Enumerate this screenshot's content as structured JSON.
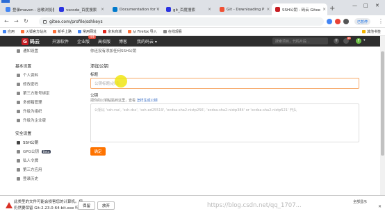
{
  "browser": {
    "tabs": [
      {
        "title": "登录maven - 谷歌浏览器",
        "color": "#4285f4"
      },
      {
        "title": "vscode_百度搜索",
        "color": "#2932e1"
      },
      {
        "title": "Documentation for V",
        "color": "#007acc"
      },
      {
        "title": "git_百度搜索",
        "color": "#2932e1"
      },
      {
        "title": "Git - Downloading P",
        "color": "#f05033"
      },
      {
        "title": "SSH公钥 - 码云 Gitee",
        "color": "#c71d23"
      }
    ],
    "url": "gitee.com/profile/sshkeys",
    "paused_label": "已暂停",
    "bookmarks": [
      {
        "label": "应用",
        "color": "#4285f4"
      },
      {
        "label": "火狐官方站点",
        "color": "#ff7139"
      },
      {
        "label": "新手上路",
        "color": "#ff7139"
      },
      {
        "label": "常用网址",
        "color": "#4285f4"
      },
      {
        "label": "京东商城",
        "color": "#e1251b"
      },
      {
        "label": "从 Firefox 导入",
        "color": "#ff7139"
      },
      {
        "label": "在线观看",
        "color": "#888888"
      }
    ],
    "other_bookmarks": "其他书签"
  },
  "gitee": {
    "logo": "码云",
    "nav": [
      "开源软件",
      "企业版",
      "高校版",
      "博客",
      "我的码云 ▾"
    ],
    "new_badge": "特惠",
    "search_placeholder": "搜索项目，代码片段...",
    "avatar_letter": "F",
    "notify_count": "46"
  },
  "sidebar": {
    "top_item": "通知设置",
    "sections": [
      {
        "title": "基本设置",
        "items": [
          "个人资料",
          "修改密码",
          "第三方账号绑定",
          "多邮箱管理",
          "升级为组织",
          "升级为企业版"
        ]
      },
      {
        "title": "安全设置",
        "items": [
          "SSH公钥",
          "GPG公钥",
          "私人令牌",
          "第三方应用",
          "登录历史"
        ]
      }
    ],
    "beta": "Beta"
  },
  "main": {
    "hint": "你还没有添加任何SSH公钥",
    "heading": "添加公钥",
    "title_label": "标题",
    "title_placeholder": "公钥标题(必填)",
    "key_label": "公钥",
    "key_sub": "把你的公钥粘贴到这里，查看",
    "key_link": "怎样生成公钥",
    "key_placeholder": "公钥以 'ssh-rsa', 'ssh-dss', 'ssh-ed25519', 'ecdsa-sha2-nistp256', 'ecdsa-sha2-nistp384' or 'ecdsa-sha2-nistp521' 开头",
    "submit": "确定"
  },
  "download": {
    "line1": "此类型的文件可能会损害您的计算机。您",
    "line2": "仍然要保留 Git-2.23.0-64-bit.exe 吗?",
    "keep": "保留",
    "discard": "放弃",
    "show_all": "全部显示"
  },
  "watermark": "https://blog.csdn.net/qq_1707..."
}
